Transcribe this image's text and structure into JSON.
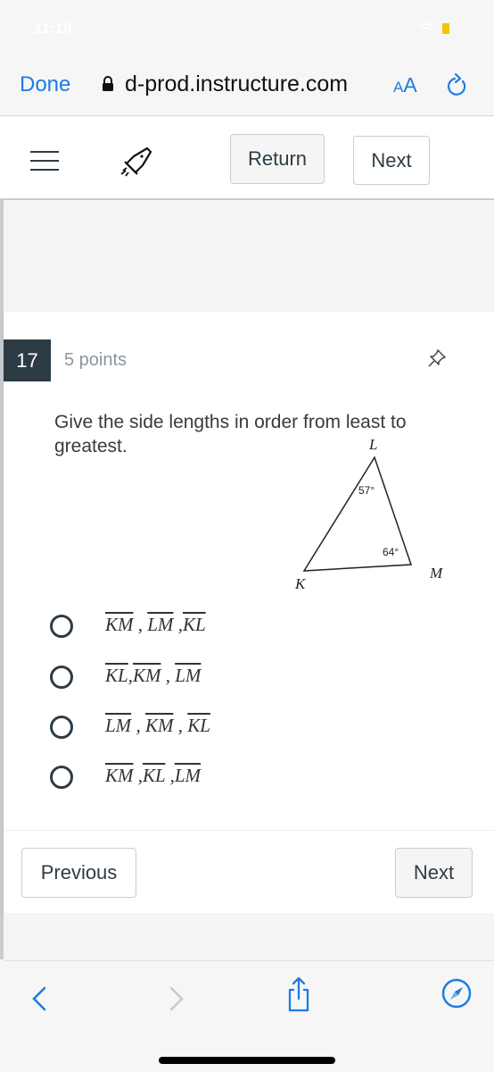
{
  "status_bar": {
    "time": "11:19"
  },
  "browser": {
    "done_label": "Done",
    "url": "d-prod.instructure.com",
    "text_size_label_small": "A",
    "text_size_label_large": "A",
    "accent_color": "#1e7be0"
  },
  "canvas_header": {
    "return_label": "Return",
    "next_label": "Next"
  },
  "question": {
    "number": "17",
    "points": "5 points",
    "prompt": "Give the side lengths in order from least to greatest.",
    "figure": {
      "vertices": [
        "L",
        "K",
        "M"
      ],
      "angle_L": "57°",
      "angle_M": "64°"
    },
    "options": [
      {
        "parts": [
          "KM",
          "LM",
          "KL"
        ],
        "selected": false
      },
      {
        "parts": [
          "KL",
          "KM",
          "LM"
        ],
        "selected": false
      },
      {
        "parts": [
          "LM",
          "KM",
          "KL"
        ],
        "selected": false
      },
      {
        "parts": [
          "KM",
          "KL",
          "LM"
        ],
        "selected": false
      }
    ]
  },
  "footer_nav": {
    "previous_label": "Previous",
    "next_label": "Next"
  },
  "colors": {
    "header_dark": "#2d3b45",
    "ios_blue": "#1e7be0",
    "battery": "#f5c400"
  }
}
